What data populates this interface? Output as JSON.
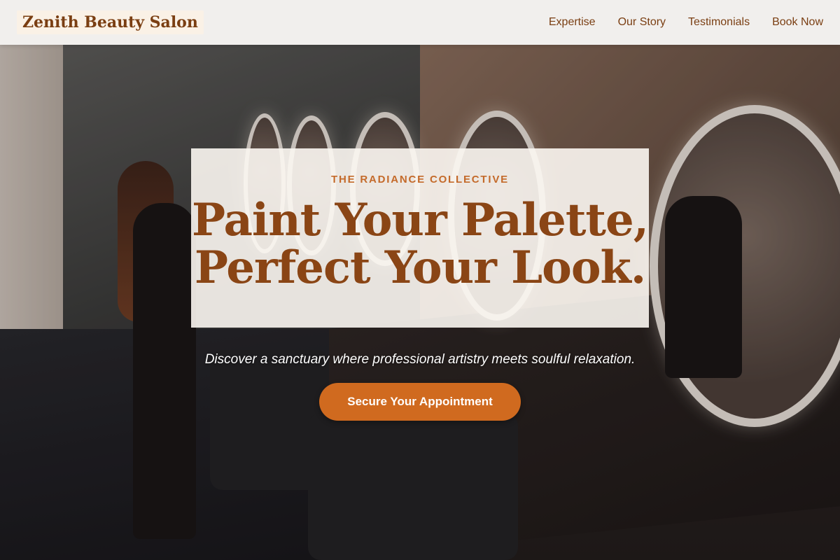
{
  "brand": {
    "name": "Zenith Beauty Salon"
  },
  "nav": {
    "items": [
      {
        "label": "Expertise"
      },
      {
        "label": "Our Story"
      },
      {
        "label": "Testimonials"
      },
      {
        "label": "Book Now"
      }
    ]
  },
  "hero": {
    "eyebrow": "THE RADIANCE COLLECTIVE",
    "headline_line1": "Paint Your Palette,",
    "headline_line2": "Perfect Your Look.",
    "tagline": "Discover a sanctuary where professional artistry meets soulful relaxation.",
    "cta_label": "Secure Your Appointment",
    "background": "salon-interior-photo"
  },
  "colors": {
    "accent": "#d06a1f",
    "brand": "#7a3e12",
    "eyebrow": "#c46a2a"
  }
}
